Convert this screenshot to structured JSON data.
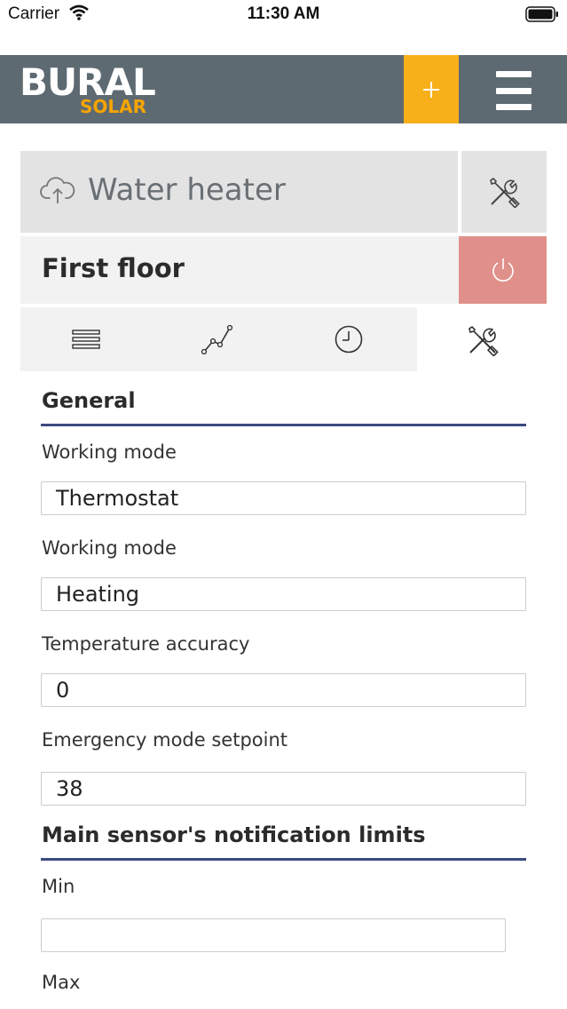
{
  "status_bar": {
    "carrier": "Carrier",
    "time": "11:30 AM"
  },
  "header": {
    "logo_main": "BURAL",
    "logo_sub": "SOLAR",
    "add_label": "+",
    "colors": {
      "bar": "#5e6a72",
      "accent": "#f7b01a"
    }
  },
  "device": {
    "name": "Water heater",
    "cloud_icon": "cloud-upload-icon",
    "tools_icon": "tools-icon"
  },
  "zone": {
    "name": "First floor",
    "power_icon": "power-icon",
    "power_color": "#e0908a"
  },
  "tabs": [
    {
      "icon": "list-icon",
      "active": false
    },
    {
      "icon": "chart-line-icon",
      "active": false
    },
    {
      "icon": "clock-icon",
      "active": false
    },
    {
      "icon": "tools-icon",
      "active": true
    }
  ],
  "sections": {
    "general": {
      "title": "General",
      "fields": [
        {
          "label": "Working mode",
          "value": "Thermostat"
        },
        {
          "label": "Working mode",
          "value": "Heating"
        },
        {
          "label": "Temperature accuracy",
          "value": "0"
        },
        {
          "label": "Emergency mode setpoint",
          "value": "38"
        }
      ]
    },
    "limits": {
      "title": "Main sensor's notification limits",
      "fields": [
        {
          "label": "Min",
          "value": ""
        },
        {
          "label": "Max",
          "value": ""
        }
      ]
    }
  }
}
